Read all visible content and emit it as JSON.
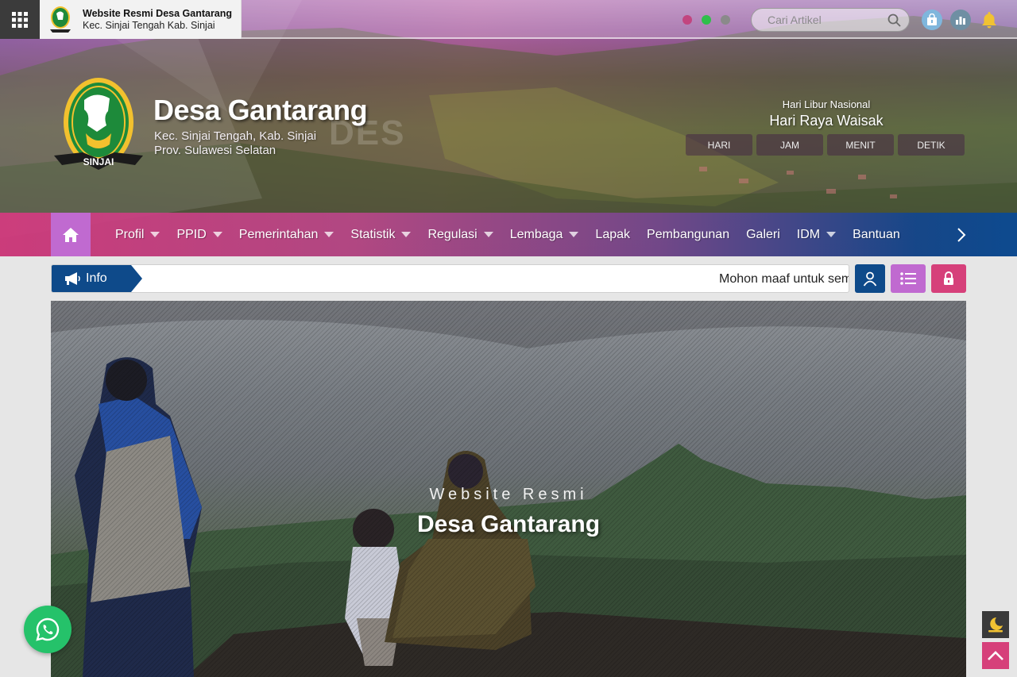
{
  "topbar": {
    "brand_title": "Website Resmi Desa Gantarang",
    "brand_subtitle": "Kec. Sinjai Tengah Kab. Sinjai",
    "search_placeholder": "Cari Artikel",
    "dot_colors": [
      "#c2457f",
      "#2fbf4a",
      "#8a8a8a"
    ]
  },
  "site": {
    "title": "Desa Gantarang",
    "subtitle_line1": "Kec. Sinjai Tengah, Kab. Sinjai",
    "subtitle_line2": "Prov. Sulawesi Selatan",
    "watermark": "DES",
    "logo_label": "SINJAI"
  },
  "holiday": {
    "caption": "Hari Libur Nasional",
    "name": "Hari Raya Waisak",
    "units": [
      "HARI",
      "JAM",
      "MENIT",
      "DETIK"
    ]
  },
  "nav": {
    "items": [
      {
        "label": "Profil",
        "dropdown": true
      },
      {
        "label": "PPID",
        "dropdown": true
      },
      {
        "label": "Pemerintahan",
        "dropdown": true
      },
      {
        "label": "Statistik",
        "dropdown": true
      },
      {
        "label": "Regulasi",
        "dropdown": true
      },
      {
        "label": "Lembaga",
        "dropdown": true
      },
      {
        "label": "Lapak",
        "dropdown": false
      },
      {
        "label": "Pembangunan",
        "dropdown": false
      },
      {
        "label": "Galeri",
        "dropdown": false
      },
      {
        "label": "IDM",
        "dropdown": true
      },
      {
        "label": "Bantuan",
        "dropdown": false
      }
    ]
  },
  "ticker": {
    "label": "Info",
    "text": "Mohon maaf untuk sem"
  },
  "hero": {
    "subtitle": "Website Resmi",
    "title": "Desa Gantarang"
  },
  "colors": {
    "nav_blue": "#0e4a8a",
    "accent_pink": "#d6407a",
    "accent_purple": "#c06ad0",
    "whatsapp_green": "#25c26a"
  }
}
